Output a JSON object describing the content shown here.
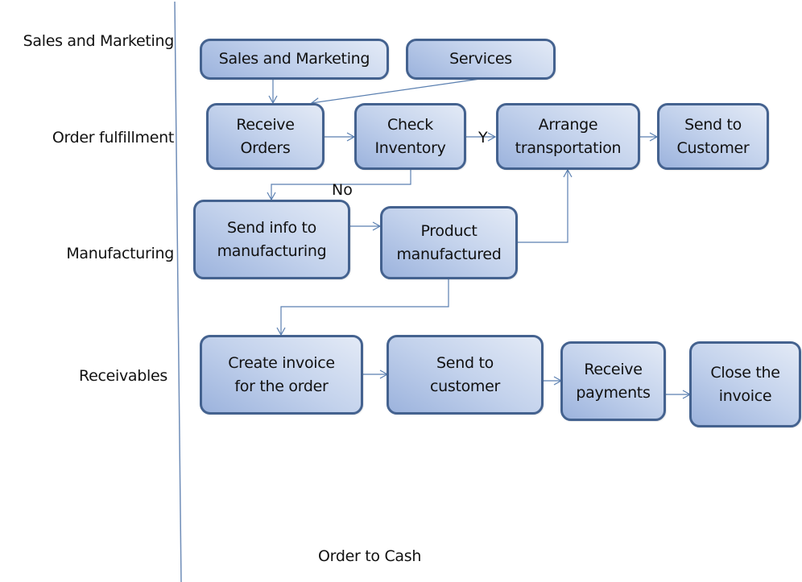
{
  "diagram": {
    "title": "Order to Cash",
    "line_color": "#5a7fb0",
    "box_border_color": "#44628f",
    "lanes": [
      {
        "id": "sales",
        "label": "Sales and Marketing"
      },
      {
        "id": "order",
        "label": "Order fulfillment"
      },
      {
        "id": "manufacturing",
        "label": "Manufacturing"
      },
      {
        "id": "receivables",
        "label": "Receivables"
      }
    ],
    "nodes": [
      {
        "id": "sales_marketing",
        "lane": "sales",
        "label": "Sales and Marketing"
      },
      {
        "id": "services",
        "lane": "sales",
        "label": "Services"
      },
      {
        "id": "receive_orders",
        "lane": "order",
        "label": "Receive\nOrders"
      },
      {
        "id": "check_inventory",
        "lane": "order",
        "label": "Check\nInventory"
      },
      {
        "id": "arrange_transport",
        "lane": "order",
        "label": "Arrange\ntransportation"
      },
      {
        "id": "send_to_customer_ship",
        "lane": "order",
        "label": "Send to\nCustomer"
      },
      {
        "id": "send_info_mfg",
        "lane": "manufacturing",
        "label": "Send info to\nmanufacturing"
      },
      {
        "id": "product_manufactured",
        "lane": "manufacturing",
        "label": "Product\nmanufactured"
      },
      {
        "id": "create_invoice",
        "lane": "receivables",
        "label": "Create invoice\nfor the order"
      },
      {
        "id": "send_invoice_customer",
        "lane": "receivables",
        "label": "Send to\ncustomer"
      },
      {
        "id": "receive_payments",
        "lane": "receivables",
        "label": "Receive\npayments"
      },
      {
        "id": "close_invoice",
        "lane": "receivables",
        "label": "Close the\ninvoice"
      }
    ],
    "edges": [
      {
        "from": "sales_marketing",
        "to": "receive_orders",
        "label": ""
      },
      {
        "from": "services",
        "to": "receive_orders",
        "label": ""
      },
      {
        "from": "receive_orders",
        "to": "check_inventory",
        "label": ""
      },
      {
        "from": "check_inventory",
        "to": "arrange_transport",
        "label": "Y"
      },
      {
        "from": "arrange_transport",
        "to": "send_to_customer_ship",
        "label": ""
      },
      {
        "from": "check_inventory",
        "to": "send_info_mfg",
        "label": "No"
      },
      {
        "from": "send_info_mfg",
        "to": "product_manufactured",
        "label": ""
      },
      {
        "from": "product_manufactured",
        "to": "arrange_transport",
        "label": ""
      },
      {
        "from": "product_manufactured",
        "to": "create_invoice",
        "label": ""
      },
      {
        "from": "create_invoice",
        "to": "send_invoice_customer",
        "label": ""
      },
      {
        "from": "send_invoice_customer",
        "to": "receive_payments",
        "label": ""
      },
      {
        "from": "receive_payments",
        "to": "close_invoice",
        "label": ""
      }
    ]
  }
}
